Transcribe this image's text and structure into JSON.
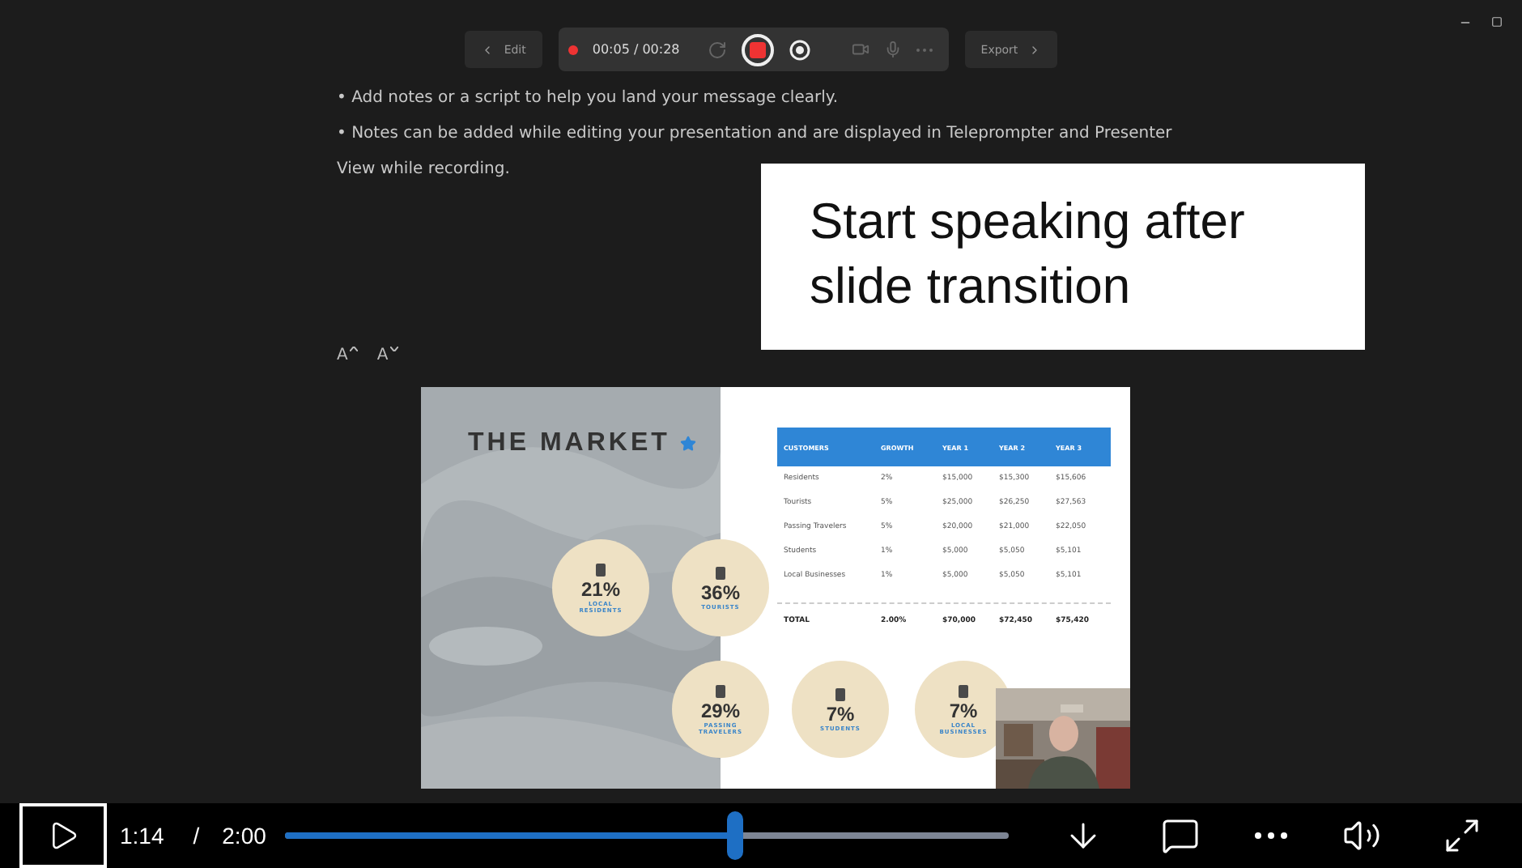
{
  "recorder_toolbar": {
    "edit_button": "Edit",
    "recording": true,
    "timer": "00:05 / 00:28",
    "export_button": "Export"
  },
  "notes": [
    "• Add notes or a script to help you land your message clearly.",
    "• Notes can be added while editing your presentation and are displayed in Teleprompter and Presenter",
    "View while recording."
  ],
  "font_size_buttons": [
    {
      "label": "A",
      "kind": "increase"
    },
    {
      "label": "A",
      "kind": "decrease"
    }
  ],
  "caption": "Start speaking after slide transition",
  "slide": {
    "title": "THE MARKET",
    "stats": [
      {
        "value": "21%",
        "label": "LOCAL RESIDENTS"
      },
      {
        "value": "36%",
        "label": "TOURISTS"
      },
      {
        "value": "29%",
        "label": "PASSING TRAVELERS"
      },
      {
        "value": "7%",
        "label": "STUDENTS"
      },
      {
        "value": "7%",
        "label": "LOCAL BUSINESSES"
      }
    ],
    "table": {
      "columns": [
        "CUSTOMERS",
        "GROWTH",
        "YEAR 1",
        "YEAR 2",
        "YEAR 3"
      ],
      "rows": [
        [
          "Residents",
          "2%",
          "$15,000",
          "$15,300",
          "$15,606"
        ],
        [
          "Tourists",
          "5%",
          "$25,000",
          "$26,250",
          "$27,563"
        ],
        [
          "Passing Travelers",
          "5%",
          "$20,000",
          "$21,000",
          "$22,050"
        ],
        [
          "Students",
          "1%",
          "$5,000",
          "$5,050",
          "$5,101"
        ],
        [
          "Local Businesses",
          "1%",
          "$5,000",
          "$5,050",
          "$5,101"
        ]
      ],
      "total": [
        "TOTAL",
        "2.00%",
        "$70,000",
        "$72,450",
        "$75,420"
      ]
    }
  },
  "player": {
    "current_time": "1:14",
    "separator": "/",
    "duration": "2:00",
    "level": 0.62
  }
}
